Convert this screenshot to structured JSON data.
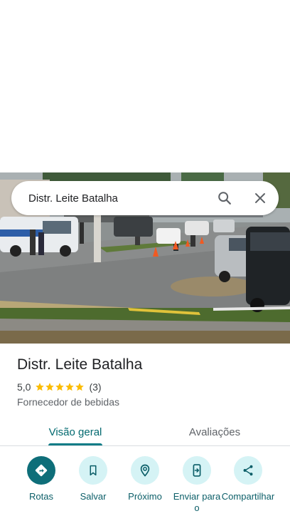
{
  "search": {
    "query": "Distr. Leite Batalha"
  },
  "place": {
    "name": "Distr. Leite Batalha",
    "rating": "5,0",
    "star_count": 5,
    "review_count": "(3)",
    "category": "Fornecedor de bebidas"
  },
  "tabs": [
    {
      "label": "Visão geral",
      "selected": true
    },
    {
      "label": "Avaliações",
      "selected": false
    }
  ],
  "actions": [
    {
      "label": "Rotas",
      "icon": "directions-icon"
    },
    {
      "label": "Salvar",
      "icon": "bookmark-icon"
    },
    {
      "label": "Próximo",
      "icon": "nearby-icon"
    },
    {
      "label": "Enviar para o",
      "icon": "send-to-phone-icon"
    },
    {
      "label": "Compartilhar",
      "icon": "share-icon"
    }
  ],
  "colors": {
    "accent": "#0e7c86",
    "primary_action": "#0e6e79",
    "action_bg": "#d5f3f5",
    "star": "#fbbc04"
  }
}
